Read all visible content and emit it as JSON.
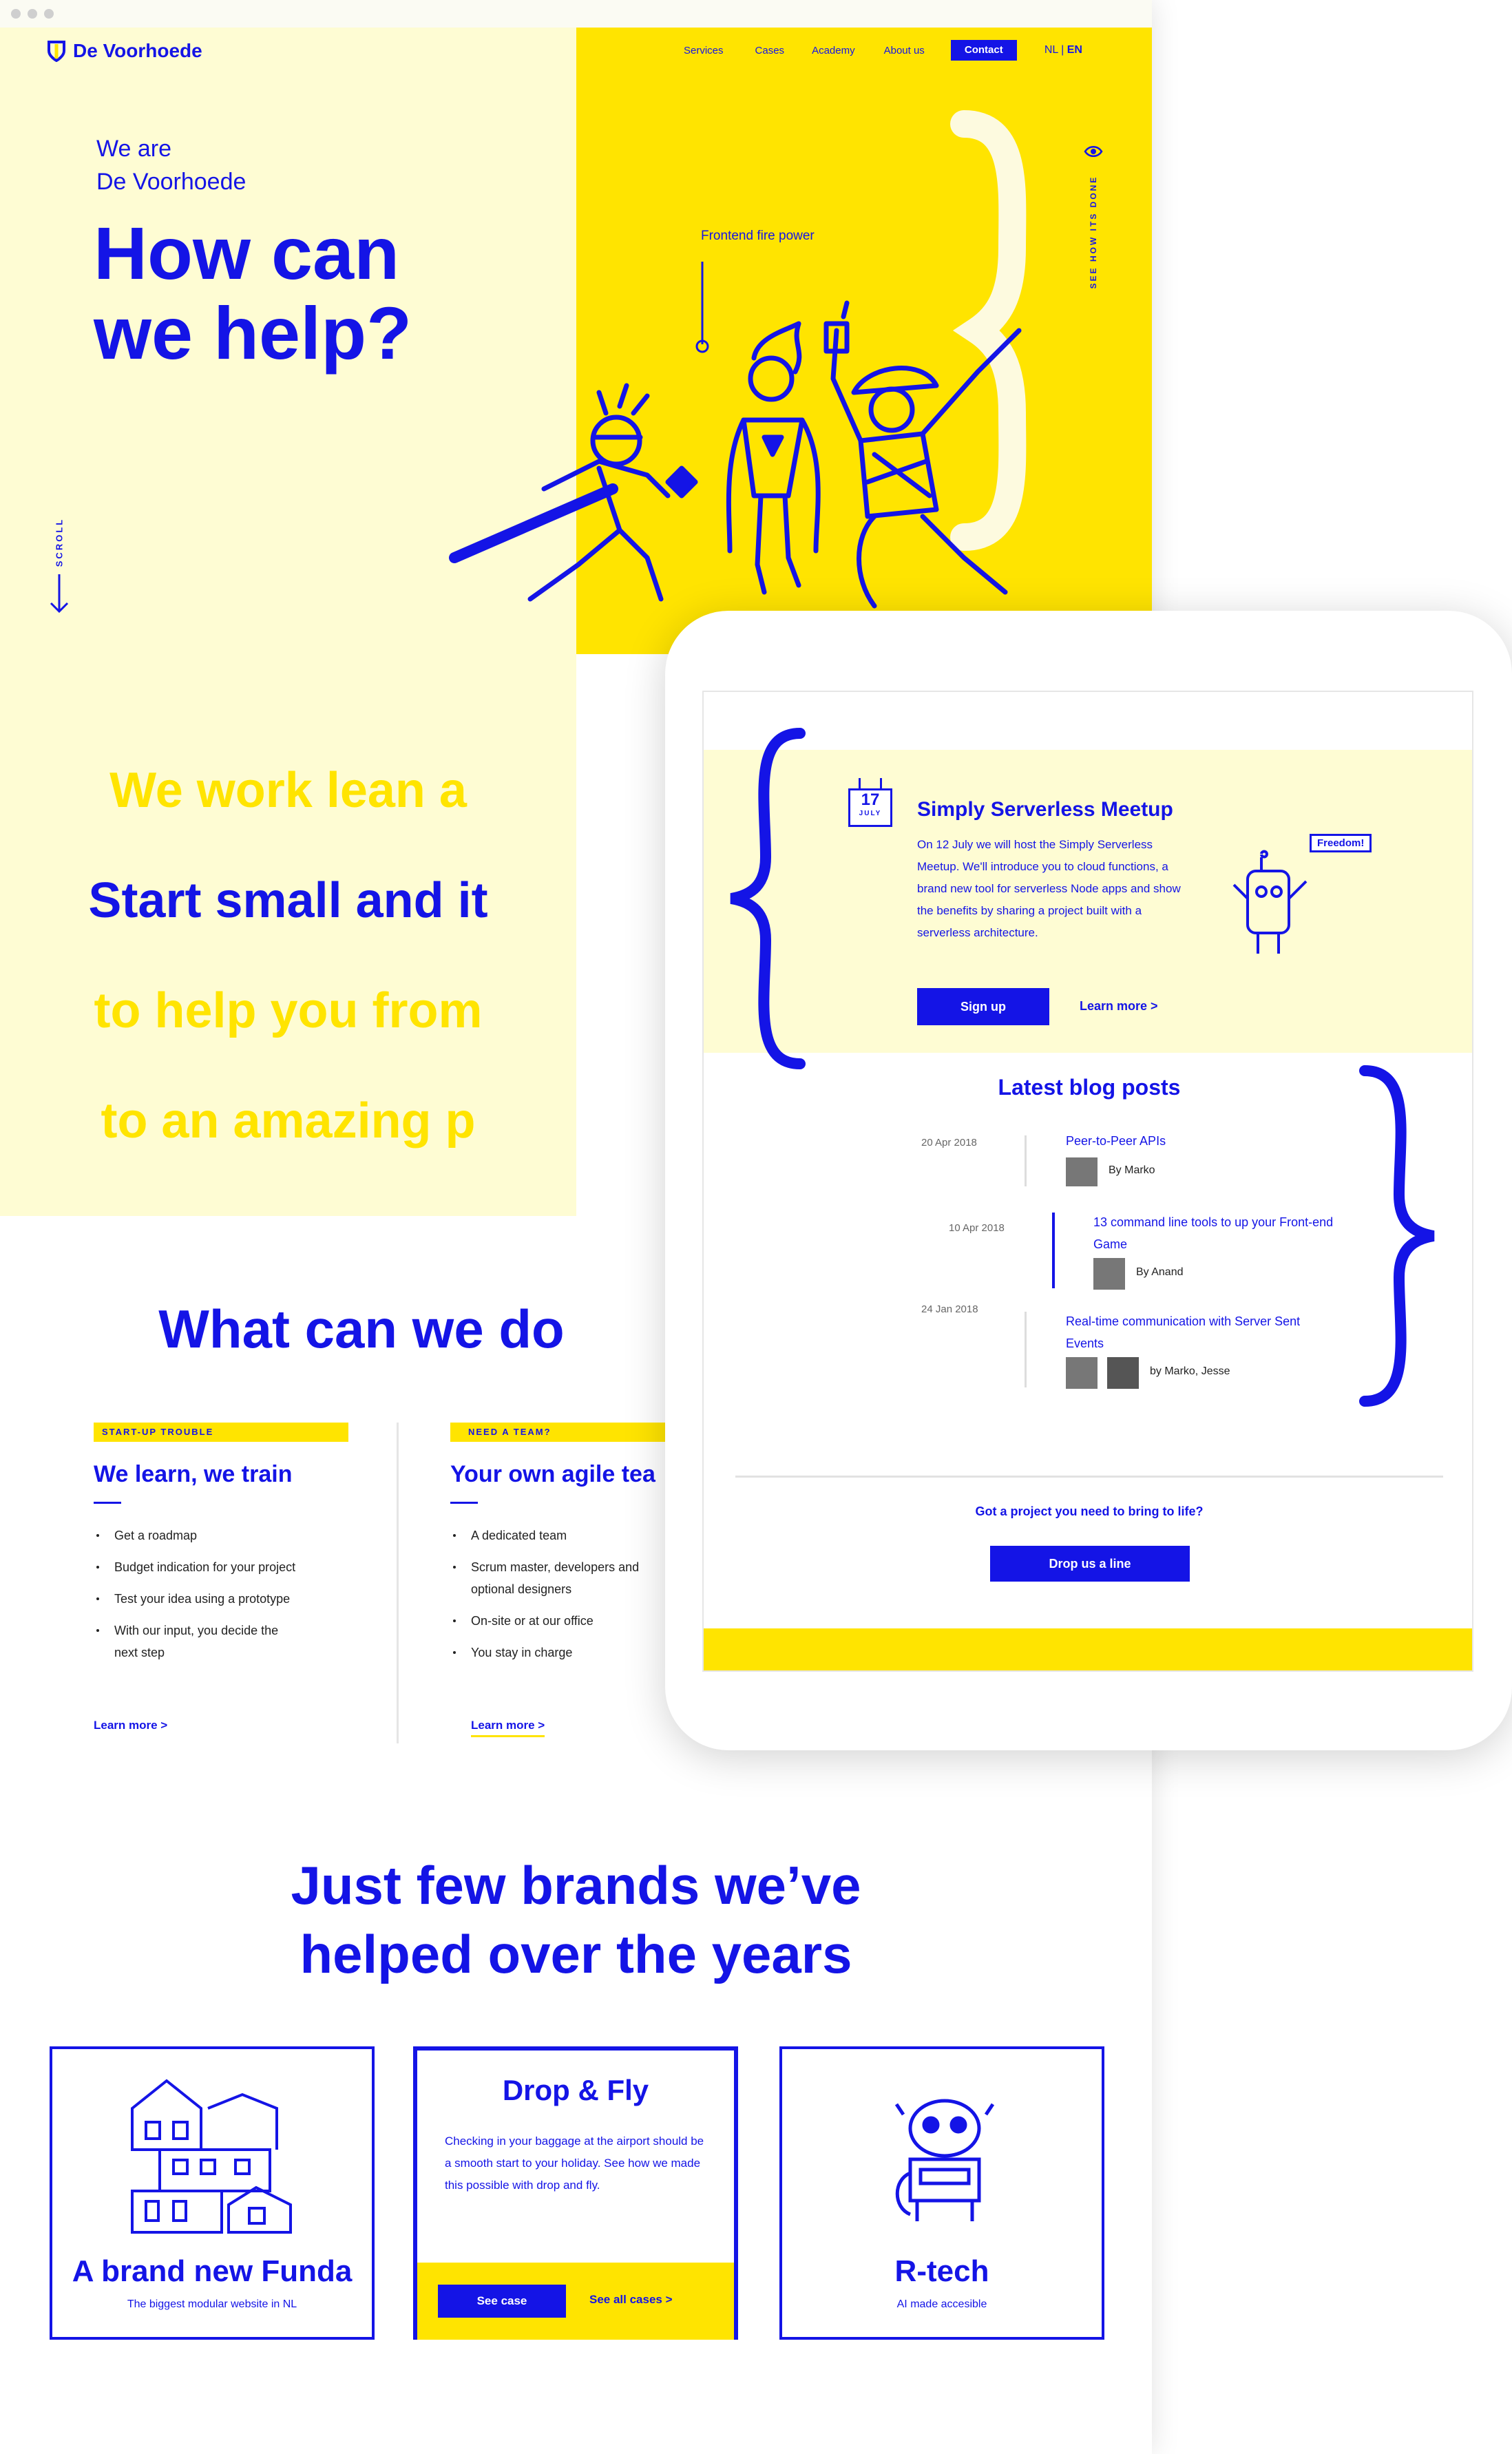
{
  "site": {
    "logo_text": "De Voorhoede",
    "nav": [
      "Services",
      "Cases",
      "Academy",
      "About us"
    ],
    "contact_label": "Contact",
    "lang_nl": "NL",
    "lang_sep": " | ",
    "lang_en": "EN"
  },
  "hero": {
    "intro_line1": "We are",
    "intro_line2": "De Voorhoede",
    "title_line1": "How can",
    "title_line2": "we help?",
    "scroll_label": "SCROLL",
    "illustration_caption": "Frontend fire power",
    "vertical_link": "SEE HOW ITS DONE"
  },
  "lean": {
    "line1": "We work lean a",
    "line2": "Start small and it",
    "line3": "to help you from",
    "line4": "to an amazing p"
  },
  "services": {
    "title": "What can we do",
    "cards": [
      {
        "tag": "START-UP TROUBLE",
        "title": "We learn, we train",
        "bullets": [
          "Get a roadmap",
          "Budget indication for your project",
          "Test your idea using a prototype",
          "With our input, you decide the next step"
        ],
        "link": "Learn more  >"
      },
      {
        "tag": "NEED A TEAM?",
        "title": "Your own agile tea",
        "bullets": [
          "A dedicated team",
          "Scrum master, developers and optional designers",
          "On-site or at our office",
          "You stay in charge"
        ],
        "link": "Learn more  >"
      }
    ]
  },
  "brands": {
    "title_line1": "Just few brands we’ve",
    "title_line2": "helped over the years",
    "cards": [
      {
        "title": "A brand new Funda",
        "subtitle": "The biggest modular website in NL"
      },
      {
        "title": "Drop & Fly",
        "text": "Checking in your baggage at the airport should be a smooth start to your holiday. See how we made this possible with drop and fly.",
        "button": "See case",
        "link": "See all cases  >"
      },
      {
        "title": "R-tech",
        "subtitle": "AI made accesible"
      }
    ]
  },
  "tablet": {
    "event": {
      "day": "17",
      "month": "JULY",
      "title": "Simply Serverless Meetup",
      "text": "On 12 July we will host the Simply Serverless Meetup. We'll introduce you to cloud functions, a brand new tool for serverless Node apps and show the benefits by sharing a project built with a serverless architecture.",
      "signup": "Sign up",
      "learn_more": "Learn more  >",
      "robot_bubble": "Freedom!"
    },
    "blog": {
      "title": "Latest blog posts",
      "posts": [
        {
          "date": "20 Apr 2018",
          "title": "Peer-to-Peer APIs",
          "author": "By Marko"
        },
        {
          "date": "10 Apr 2018",
          "title": "13 command line tools to up your Front-end Game",
          "author": "By Anand"
        },
        {
          "date": "24 Jan 2018",
          "title": "Real-time communication with Server Sent Events",
          "author": "by Marko, Jesse"
        }
      ]
    },
    "cta": {
      "question": "Got a project you need to bring to life?",
      "button": "Drop us a line"
    }
  },
  "colors": {
    "blue": "#1414e6",
    "yellow": "#ffe400",
    "cream": "#fefcd3"
  }
}
